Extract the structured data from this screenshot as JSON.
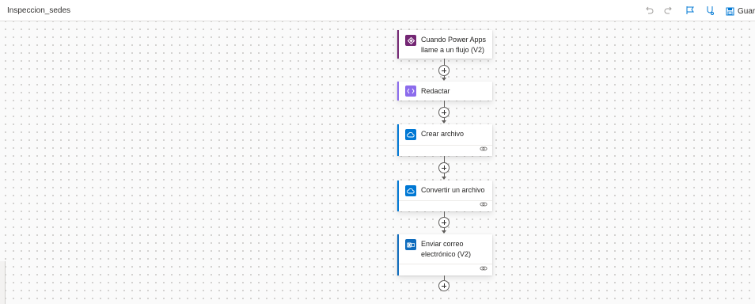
{
  "header": {
    "flow_name": "Inspeccion_sedes",
    "save_label": "Guard",
    "icons": [
      "undo-icon",
      "redo-icon",
      "flow-checker-icon",
      "test-icon",
      "save-icon"
    ]
  },
  "colors": {
    "powerapps": "#742774",
    "compose": "#8c6cec",
    "onedrive": "#0078d4",
    "outlook": "#0f6cbd",
    "connector": "#605e5c"
  },
  "flow": {
    "steps": [
      {
        "label": "Cuando Power Apps llame a un flujo (V2)",
        "icon": "powerapps-icon"
      },
      {
        "label": "Redactar",
        "icon": "compose-icon"
      },
      {
        "label": "Crear archivo",
        "icon": "onedrive-icon"
      },
      {
        "label": "Convertir un archivo",
        "icon": "onedrive-icon"
      },
      {
        "label": "Enviar correo electrónico (V2)",
        "icon": "outlook-icon"
      }
    ]
  }
}
